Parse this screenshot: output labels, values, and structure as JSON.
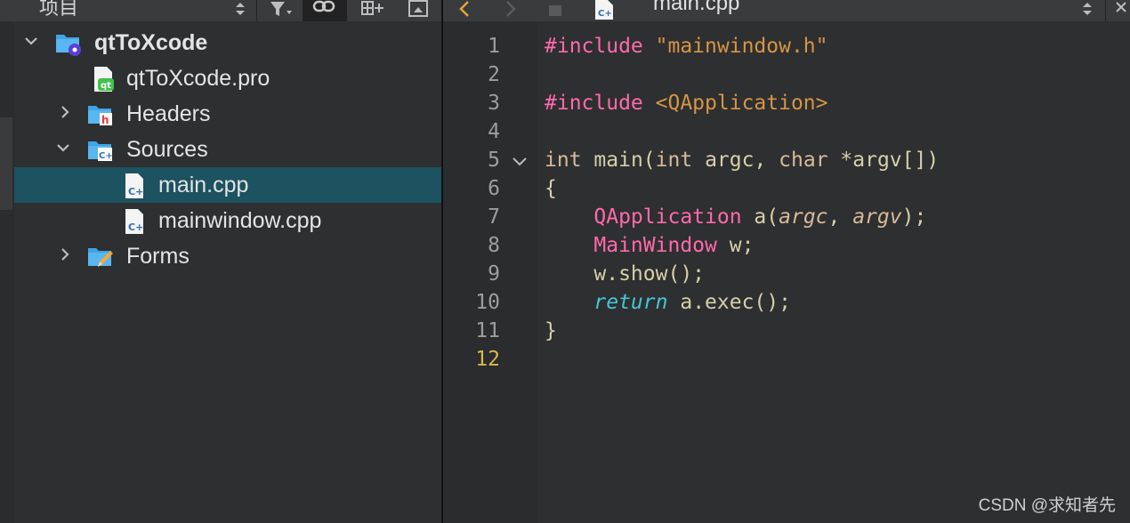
{
  "left_pane": {
    "title": "项目",
    "tree": [
      {
        "label": "qtToXcode",
        "kind": "project",
        "expanded": true,
        "bold": true
      },
      {
        "label": "qtToXcode.pro",
        "kind": "pro-file"
      },
      {
        "label": "Headers",
        "kind": "folder-headers",
        "expanded": false
      },
      {
        "label": "Sources",
        "kind": "folder-sources",
        "expanded": true
      },
      {
        "label": "main.cpp",
        "kind": "cpp-file",
        "selected": true
      },
      {
        "label": "mainwindow.cpp",
        "kind": "cpp-file"
      },
      {
        "label": "Forms",
        "kind": "folder-forms",
        "expanded": false
      }
    ]
  },
  "editor": {
    "tab_label": "main.cpp",
    "current_line": 12,
    "line_numbers": [
      "1",
      "2",
      "3",
      "4",
      "5",
      "6",
      "7",
      "8",
      "9",
      "10",
      "11",
      "12"
    ],
    "code": {
      "l1_pre": "#include",
      "l1_str": "\"mainwindow.h\"",
      "l3_pre": "#include",
      "l3_str": "<QApplication>",
      "l5_int": "int",
      "l5_main": "main(",
      "l5_int2": "int",
      "l5_argc": "argc,",
      "l5_char": "char",
      "l5_argv": "*argv[])",
      "l6": "{",
      "l7_cls": "QApplication",
      "l7_a": "a(",
      "l7_argc": "argc",
      "l7_comma": ",",
      "l7_argv": "argv",
      "l7_end": ");",
      "l8_cls": "MainWindow",
      "l8_w": "w;",
      "l9": "w.show();",
      "l10_ret": "return",
      "l10_rest": "a.exec();",
      "l11": "}"
    }
  },
  "watermark": "CSDN @求知者先",
  "colors": {
    "background": "#2e2f30",
    "selection": "#1d5260",
    "preprocessor": "#ff6aad",
    "string": "#d69545",
    "keyword_return": "#45c6d6",
    "current_line_number": "#d7b94b"
  }
}
